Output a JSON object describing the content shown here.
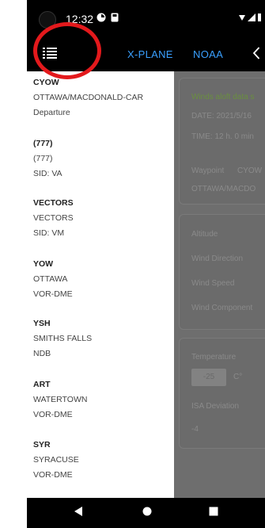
{
  "status_bar": {
    "time": "12:32"
  },
  "toolbar": {
    "tabs": [
      {
        "label": "X-PLANE"
      },
      {
        "label": "NOAA"
      }
    ]
  },
  "drawer": {
    "items": [
      {
        "code": "CYOW",
        "name": "OTTAWA/MACDONALD-CAR",
        "type": "Departure"
      },
      {
        "code": "(777)",
        "name": "(777)",
        "type": "SID: VA"
      },
      {
        "code": "VECTORS",
        "name": "VECTORS",
        "type": "SID: VM"
      },
      {
        "code": "YOW",
        "name": "OTTAWA",
        "type": "VOR-DME"
      },
      {
        "code": "YSH",
        "name": "SMITHS FALLS",
        "type": "NDB"
      },
      {
        "code": "ART",
        "name": "WATERTOWN",
        "type": "VOR-DME"
      },
      {
        "code": "SYR",
        "name": "SYRACUSE",
        "type": "VOR-DME"
      }
    ]
  },
  "main": {
    "winds_title": "Winds aloft data s",
    "date": "DATE: 2021/5/16",
    "time": "TIME: 12 h. 0 min",
    "waypoint_label": "Waypoint",
    "waypoint_value": "CYOW",
    "waypoint_name": "OTTAWA/MACDO",
    "altitude_label": "Altitude",
    "wind_direction_label": "Wind Direction",
    "wind_speed_label": "Wind Speed",
    "wind_component_label": "Wind Component",
    "temperature_label": "Temperature",
    "temperature_value": "-25",
    "temperature_unit": "C°",
    "isa_label": "ISA Deviation",
    "isa_value": "-4"
  },
  "colors": {
    "accent": "#3aa0ff",
    "annotation": "#e3191c",
    "overlay": "#6e6e6e"
  },
  "icons": [
    "menu-icon",
    "back-chevron-icon",
    "nav-back-icon",
    "nav-home-icon",
    "nav-recents-icon"
  ]
}
